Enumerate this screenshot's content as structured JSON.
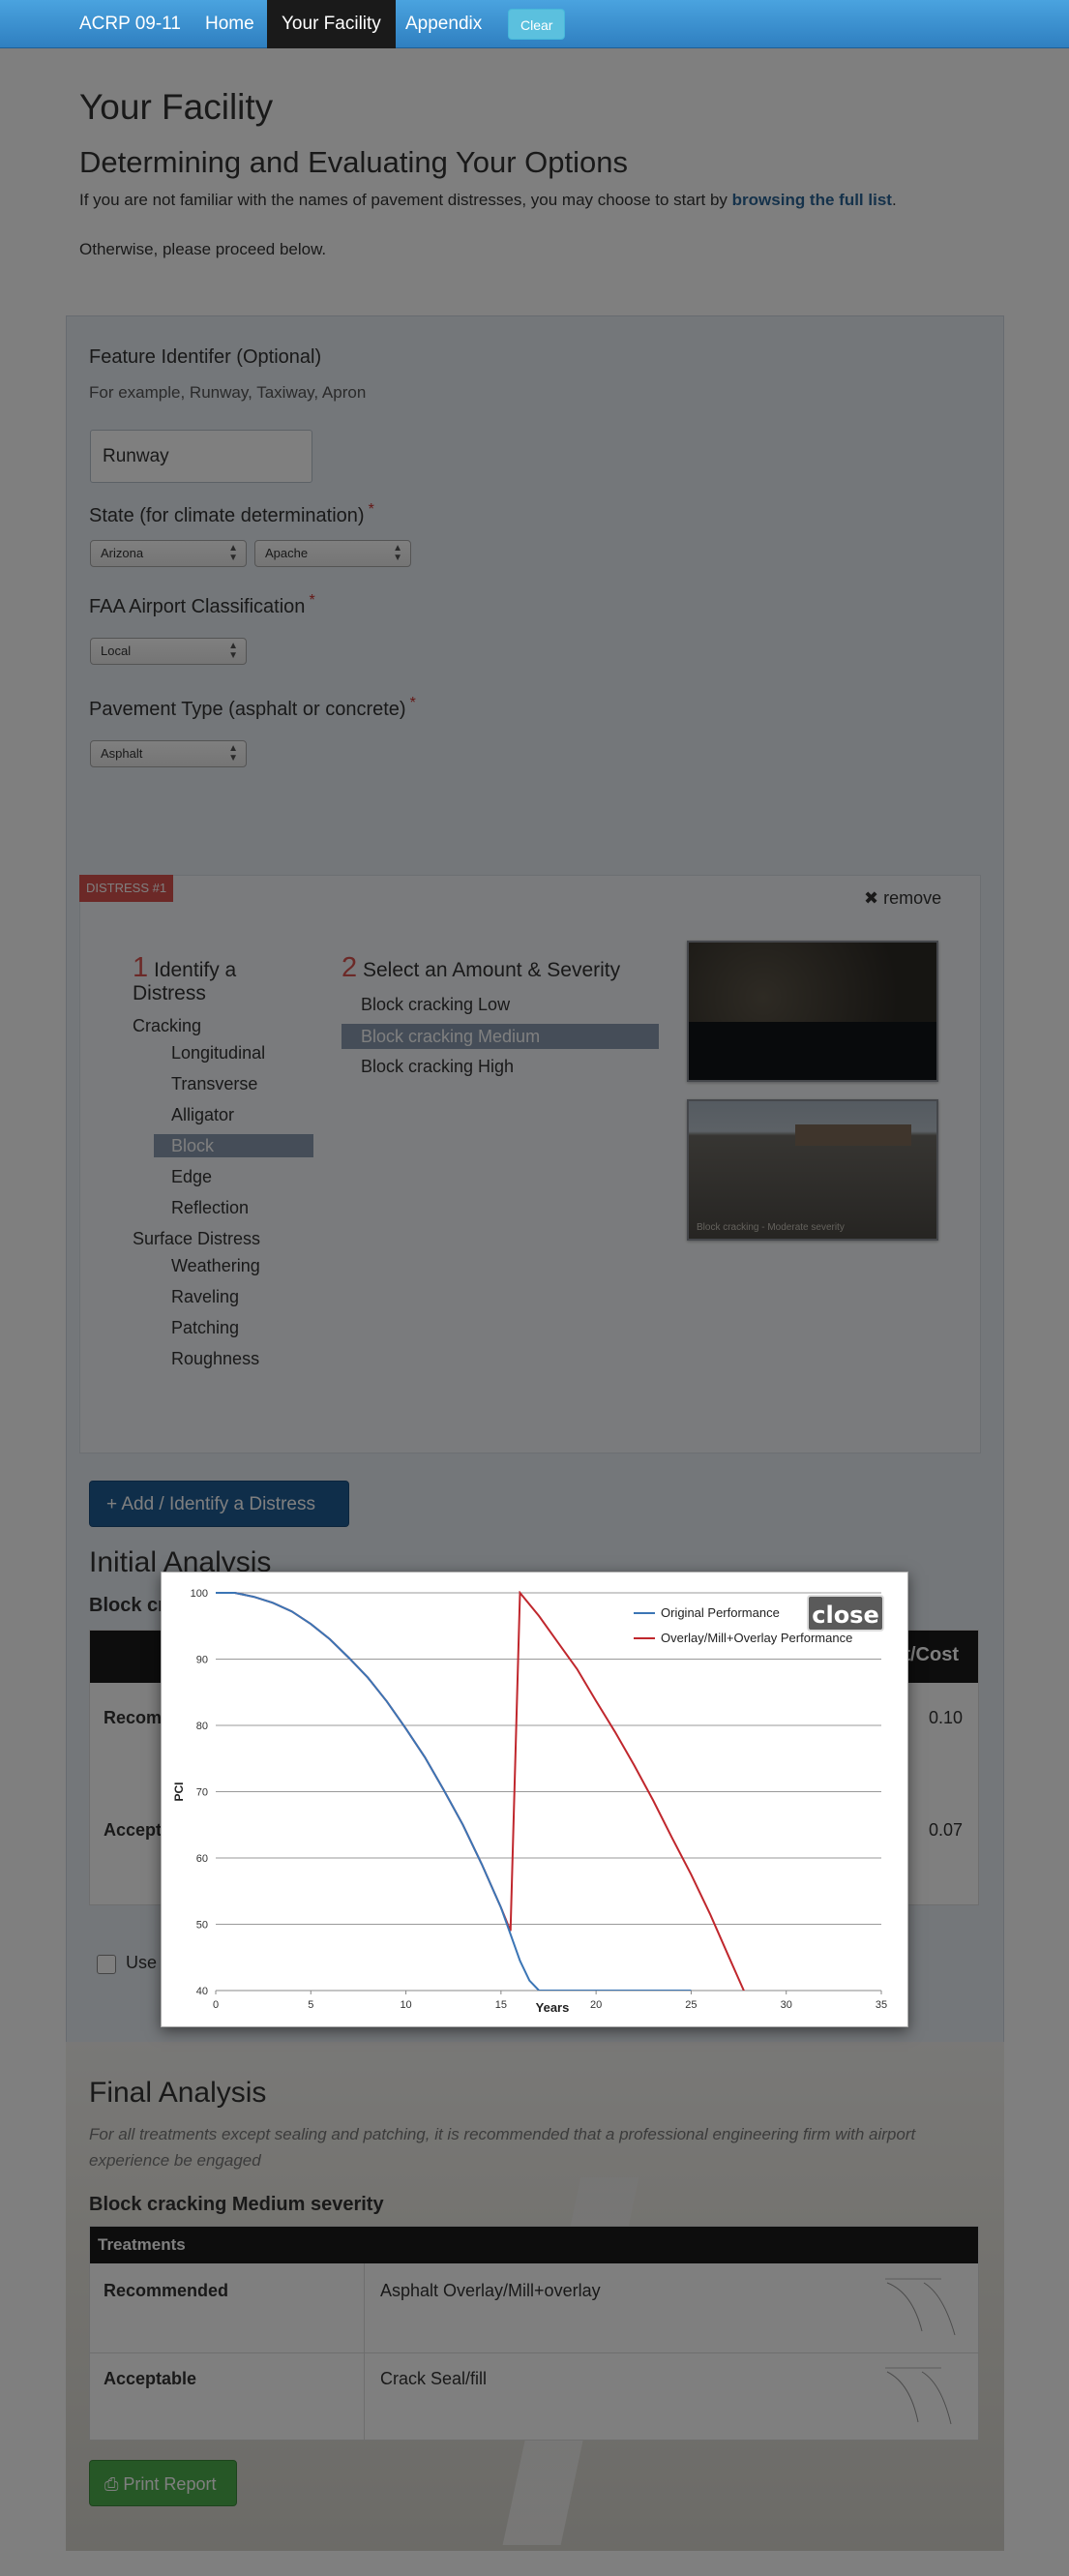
{
  "nav": {
    "brand": "ACRP 09-11",
    "items": [
      "Home",
      "Your Facility",
      "Appendix"
    ],
    "active": "Your Facility",
    "clear_label": "Clear"
  },
  "page": {
    "title": "Your Facility",
    "subtitle": "Determining and Evaluating Your Options",
    "intro_prefix": "If you are not familiar with the names of pavement distresses, you may choose to start by ",
    "intro_link": "browsing the full list",
    "intro_suffix": ".",
    "intro2": "Otherwise, please proceed below."
  },
  "form": {
    "feature_label": "Feature Identifer (Optional)",
    "feature_help": "For example, Runway, Taxiway, Apron",
    "feature_value": "Runway",
    "state_label": "State (for climate determination)",
    "state_value": "Arizona",
    "county_value": "Apache",
    "faa_label": "FAA Airport Classification",
    "faa_value": "Local",
    "pavement_label": "Pavement Type (asphalt or concrete)",
    "pavement_value": "Asphalt",
    "required_mark": "*"
  },
  "distress": {
    "badge": "DISTRESS #1",
    "remove_label": "remove",
    "step1_num": "1",
    "step1_title": "Identify a Distress",
    "step2_num": "2",
    "step2_title": "Select an Amount & Severity",
    "categories": [
      {
        "name": "Cracking",
        "items": [
          "Longitudinal",
          "Transverse",
          "Alligator",
          "Block",
          "Edge",
          "Reflection"
        ]
      },
      {
        "name": "Surface Distress",
        "items": [
          "Weathering",
          "Raveling",
          "Patching",
          "Roughness"
        ]
      }
    ],
    "selected_item": "Block",
    "severities": [
      "Block cracking Low",
      "Block cracking Medium",
      "Block cracking High"
    ],
    "selected_severity": "Block cracking Medium",
    "photo_caption": "Block cracking - Moderate severity"
  },
  "add_button": "+ Add / Identify a Distress",
  "initial_analysis": {
    "title": "Initial Analysis",
    "subtitle": "Block cra",
    "cost_header": "t/Cost",
    "rows": [
      {
        "label": "Recom",
        "value": "0.10"
      },
      {
        "label": "Accept",
        "value": "0.07"
      }
    ],
    "checkbox_label": "Use"
  },
  "final_analysis": {
    "title": "Final Analysis",
    "note": "For all treatments except sealing and patching, it is recommended that a professional engineering firm with airport experience be engaged",
    "subtitle": "Block cracking Medium severity",
    "table_header": "Treatments",
    "rows": [
      {
        "label": "Recommended",
        "treatment": "Asphalt Overlay/Mill+overlay"
      },
      {
        "label": "Acceptable",
        "treatment": "Crack Seal/fill"
      }
    ],
    "print_label": "Print Report"
  },
  "modal": {
    "close_label": "close"
  },
  "chart_data": {
    "type": "line",
    "title": "",
    "xlabel": "Years",
    "ylabel": "PCI",
    "xlim": [
      0,
      35
    ],
    "ylim": [
      40,
      100
    ],
    "xticks": [
      0,
      5,
      10,
      15,
      20,
      25,
      30,
      35
    ],
    "yticks": [
      40,
      50,
      60,
      70,
      80,
      90,
      100
    ],
    "grid": "horizontal",
    "legend": "top-right",
    "series": [
      {
        "name": "Original Performance",
        "color": "#3b75b5",
        "x": [
          0,
          1,
          2,
          3,
          4,
          5,
          6,
          7,
          8,
          9,
          10,
          11,
          12,
          13,
          14,
          15,
          16,
          16.5,
          17,
          20,
          25
        ],
        "y": [
          100,
          100,
          99.4,
          98.5,
          97.2,
          95.3,
          93,
          90.2,
          87.2,
          83.6,
          79.5,
          75.2,
          70.2,
          65,
          59,
          52.5,
          44.5,
          41.5,
          40,
          40,
          40
        ]
      },
      {
        "name": "Overlay/Mill+Overlay Performance",
        "color": "#c0272d",
        "x": [
          0,
          1,
          2,
          3,
          4,
          5,
          6,
          7,
          8,
          9,
          10,
          11,
          12,
          13,
          14,
          15,
          15.5,
          16,
          17,
          18,
          19,
          20,
          21,
          22,
          23,
          24,
          25,
          26,
          27,
          28,
          28.6
        ],
        "y": [
          100,
          100,
          99.4,
          98.5,
          97.2,
          95.3,
          93,
          90.2,
          87.2,
          83.6,
          79.5,
          75.2,
          70.2,
          65,
          59,
          52.5,
          49,
          100,
          96.5,
          92.5,
          88.5,
          83.7,
          79,
          74,
          68.7,
          63,
          57.5,
          51.5,
          45,
          38.5,
          34
        ]
      }
    ]
  }
}
